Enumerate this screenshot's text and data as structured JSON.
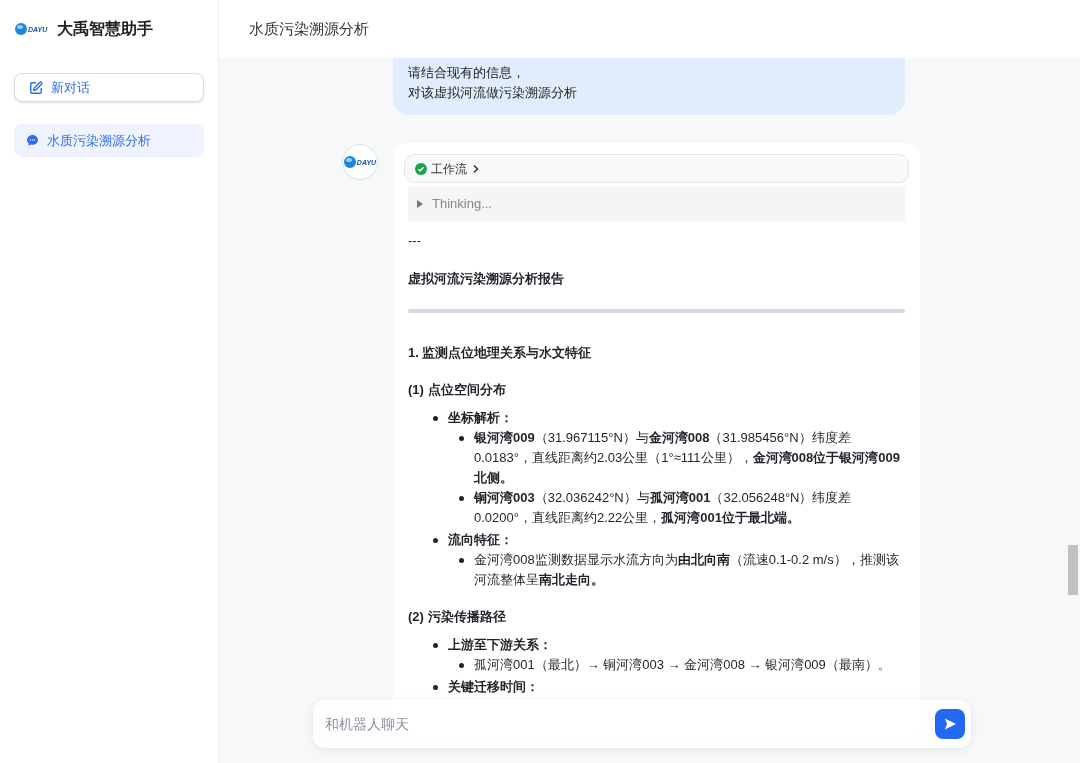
{
  "sidebar": {
    "app_name": "大禹智慧助手",
    "logo_text": "DAYU",
    "new_chat": "新对话",
    "conversations": [
      {
        "title": "水质污染溯源分析",
        "selected": true
      }
    ]
  },
  "header": {
    "title": "水质污染溯源分析"
  },
  "user_message": {
    "lines": [
      "请结合现有的信息，",
      "对该虚拟河流做污染溯源分析"
    ]
  },
  "assistant": {
    "avatar_text": "DAYU",
    "workflow": {
      "label": "工作流",
      "done": true
    },
    "thinking": {
      "label": "Thinking...",
      "expanded": false
    },
    "blocks": [
      {
        "kind": "text",
        "text": "---"
      },
      {
        "kind": "title",
        "text": "虚拟河流污染溯源分析报告"
      },
      {
        "kind": "divider"
      },
      {
        "kind": "heading",
        "text": "1. 监测点位地理关系与水文特征"
      },
      {
        "kind": "subheading",
        "text": "(1) 点位空间分布"
      },
      {
        "kind": "list",
        "items": [
          {
            "text": "坐标解析：",
            "children": [
              {
                "text": "**银河湾009**（31.967115°N）与**金河湾008**（31.985456°N）纬度差0.0183°，直线距离约2.03公里（1°≈111公里），**金河湾008位于银河湾009北侧。**"
              },
              {
                "text": "**铜河湾003**（32.036242°N）与**孤河湾001**（32.056248°N）纬度差0.0200°，直线距离约2.22公里，**孤河湾001位于最北端。**"
              }
            ]
          },
          {
            "text": "流向特征：",
            "children": [
              {
                "text": "金河湾008监测数据显示水流方向为**由北向南**（流速0.1-0.2 m/s），推测该河流整体呈**南北走向。**"
              }
            ]
          }
        ]
      },
      {
        "kind": "subheading",
        "text": "(2) 污染传播路径"
      },
      {
        "kind": "list",
        "items": [
          {
            "text": "上游至下游关系：",
            "children": [
              {
                "text": "孤河湾001（最北）→ 铜河湾003 → 金河湾008 → 银河湾009（最南）。"
              }
            ]
          },
          {
            "text": "关键迁移时间："
          }
        ]
      }
    ]
  },
  "chat_input": {
    "placeholder": "和机器人聊天"
  }
}
